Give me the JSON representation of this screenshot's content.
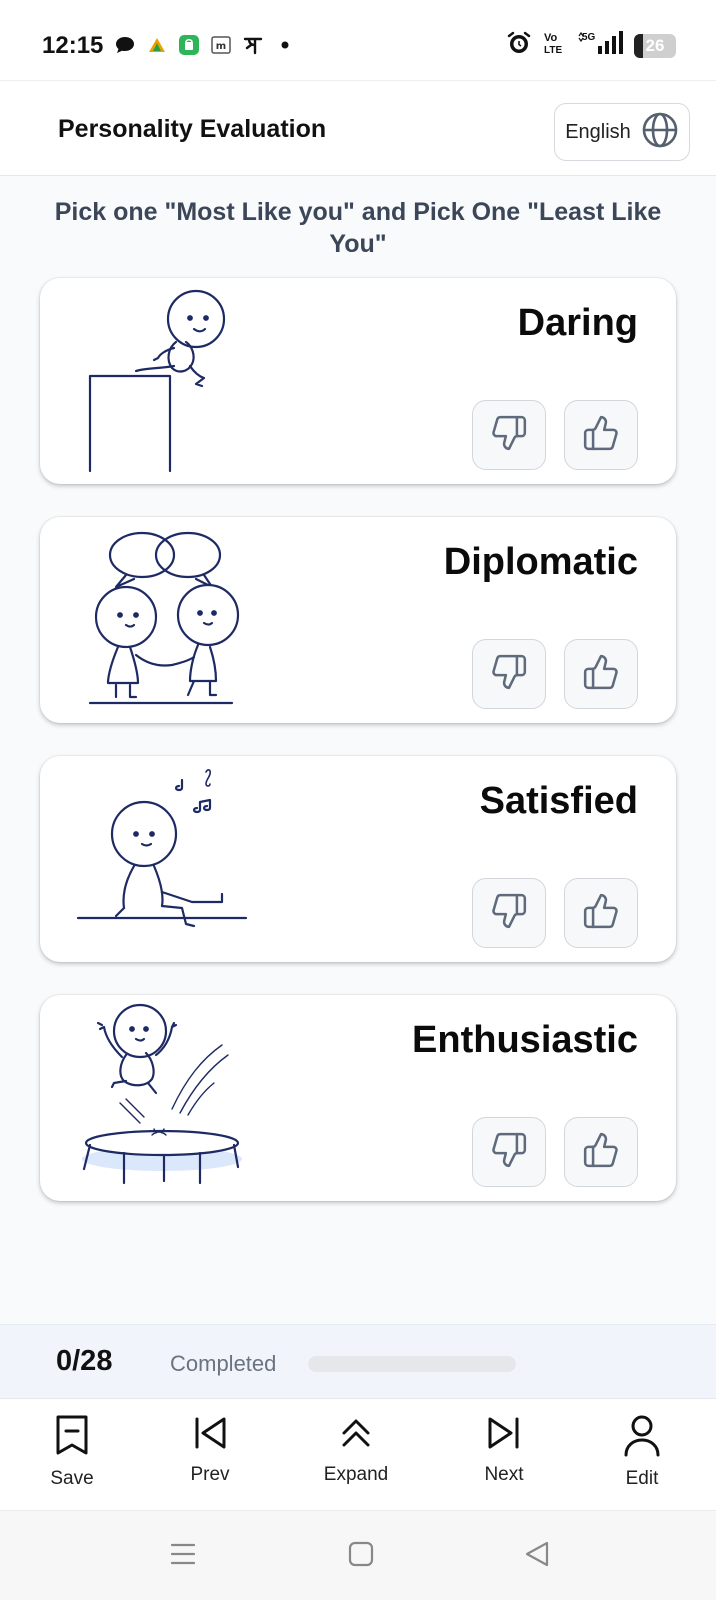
{
  "status_bar": {
    "time": "12:15",
    "left_icons": [
      "chat-bubble-icon",
      "triangle-app-icon",
      "store-app-icon",
      "m-app-icon",
      "phonepe-icon",
      "dot-icon"
    ],
    "right_icons": [
      "alarm-icon",
      "volte-icon",
      "5g-signal-icon"
    ],
    "battery": "26"
  },
  "header": {
    "title": "Personality Evaluation",
    "language_label": "English",
    "language_icon": "globe-icon"
  },
  "instruction": "Pick one \"Most Like you\" and Pick One \"Least Like You\"",
  "cards": [
    {
      "word": "Daring",
      "illustration": "jumping-off-box"
    },
    {
      "word": "Diplomatic",
      "illustration": "handshake-speech-bubbles"
    },
    {
      "word": "Satisfied",
      "illustration": "sitting-with-music-notes"
    },
    {
      "word": "Enthusiastic",
      "illustration": "trampoline-jump"
    }
  ],
  "vote_icons": {
    "least": "thumbs-down-icon",
    "most": "thumbs-up-icon"
  },
  "progress": {
    "count": "0/28",
    "label": "Completed",
    "fraction": 0
  },
  "nav": {
    "save": "Save",
    "prev": "Prev",
    "expand": "Expand",
    "next": "Next",
    "edit": "Edit"
  },
  "colors": {
    "ink": "#1e2a63",
    "accent": "#3b82f6",
    "muted": "#6b7280"
  }
}
